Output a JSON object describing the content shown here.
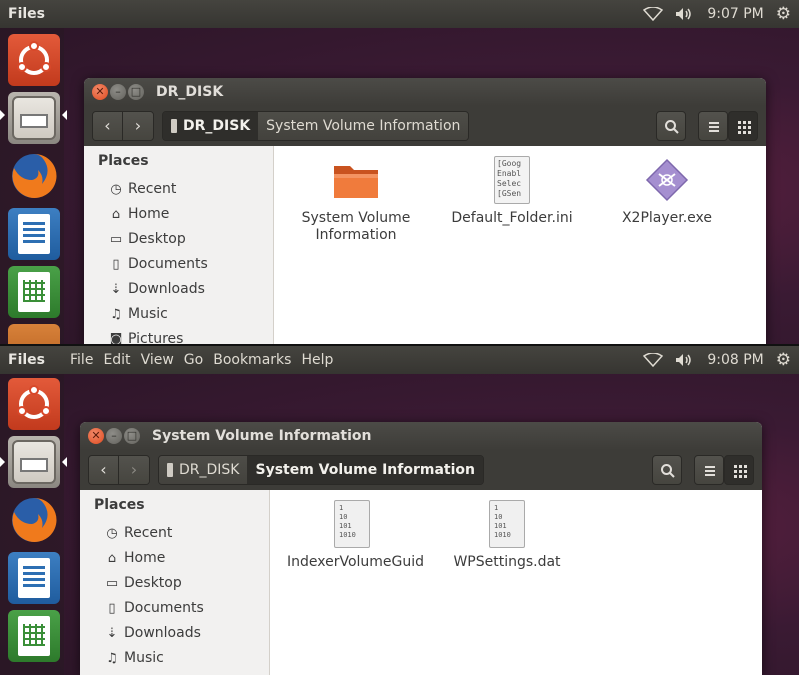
{
  "shot1": {
    "topbar": {
      "app": "Files",
      "menus": [],
      "time": "9:07 PM"
    },
    "window": {
      "title": "DR_DISK",
      "breadcrumb": [
        {
          "label": "DR_DISK",
          "active": true
        },
        {
          "label": "System Volume Information",
          "active": false
        }
      ],
      "sidebar": {
        "heading": "Places",
        "items": [
          {
            "label": "Recent",
            "icon": "clock-icon"
          },
          {
            "label": "Home",
            "icon": "home-icon"
          },
          {
            "label": "Desktop",
            "icon": "folder-icon"
          },
          {
            "label": "Documents",
            "icon": "document-icon"
          },
          {
            "label": "Downloads",
            "icon": "download-icon"
          },
          {
            "label": "Music",
            "icon": "music-icon"
          },
          {
            "label": "Pictures",
            "icon": "camera-icon"
          }
        ]
      },
      "files": [
        {
          "name": "System Volume Information",
          "icon": "folder-icon"
        },
        {
          "name": "Default_Folder.ini",
          "icon": "text-file-icon",
          "preview": [
            "[Goog",
            "Enabl",
            "Selec",
            "[GSen"
          ]
        },
        {
          "name": "X2Player.exe",
          "icon": "executable-icon"
        }
      ]
    }
  },
  "shot2": {
    "topbar": {
      "app": "Files",
      "menus": [
        "File",
        "Edit",
        "View",
        "Go",
        "Bookmarks",
        "Help"
      ],
      "time": "9:08 PM"
    },
    "window": {
      "title": "System Volume Information",
      "breadcrumb": [
        {
          "label": "DR_DISK",
          "active": false
        },
        {
          "label": "System Volume Information",
          "active": true
        }
      ],
      "sidebar": {
        "heading": "Places",
        "items": [
          {
            "label": "Recent",
            "icon": "clock-icon"
          },
          {
            "label": "Home",
            "icon": "home-icon"
          },
          {
            "label": "Desktop",
            "icon": "folder-icon"
          },
          {
            "label": "Documents",
            "icon": "document-icon"
          },
          {
            "label": "Downloads",
            "icon": "download-icon"
          },
          {
            "label": "Music",
            "icon": "music-icon"
          }
        ]
      },
      "files": [
        {
          "name": "IndexerVolumeGuid",
          "icon": "binary-file-icon",
          "preview": [
            "1",
            "10",
            "101",
            "1010"
          ]
        },
        {
          "name": "WPSettings.dat",
          "icon": "binary-file-icon",
          "preview": [
            "1",
            "10",
            "101",
            "1010"
          ]
        }
      ]
    }
  },
  "colors": {
    "accent": "#df4a1f",
    "panel": "#3c3b37",
    "folder": "#e8662e"
  }
}
